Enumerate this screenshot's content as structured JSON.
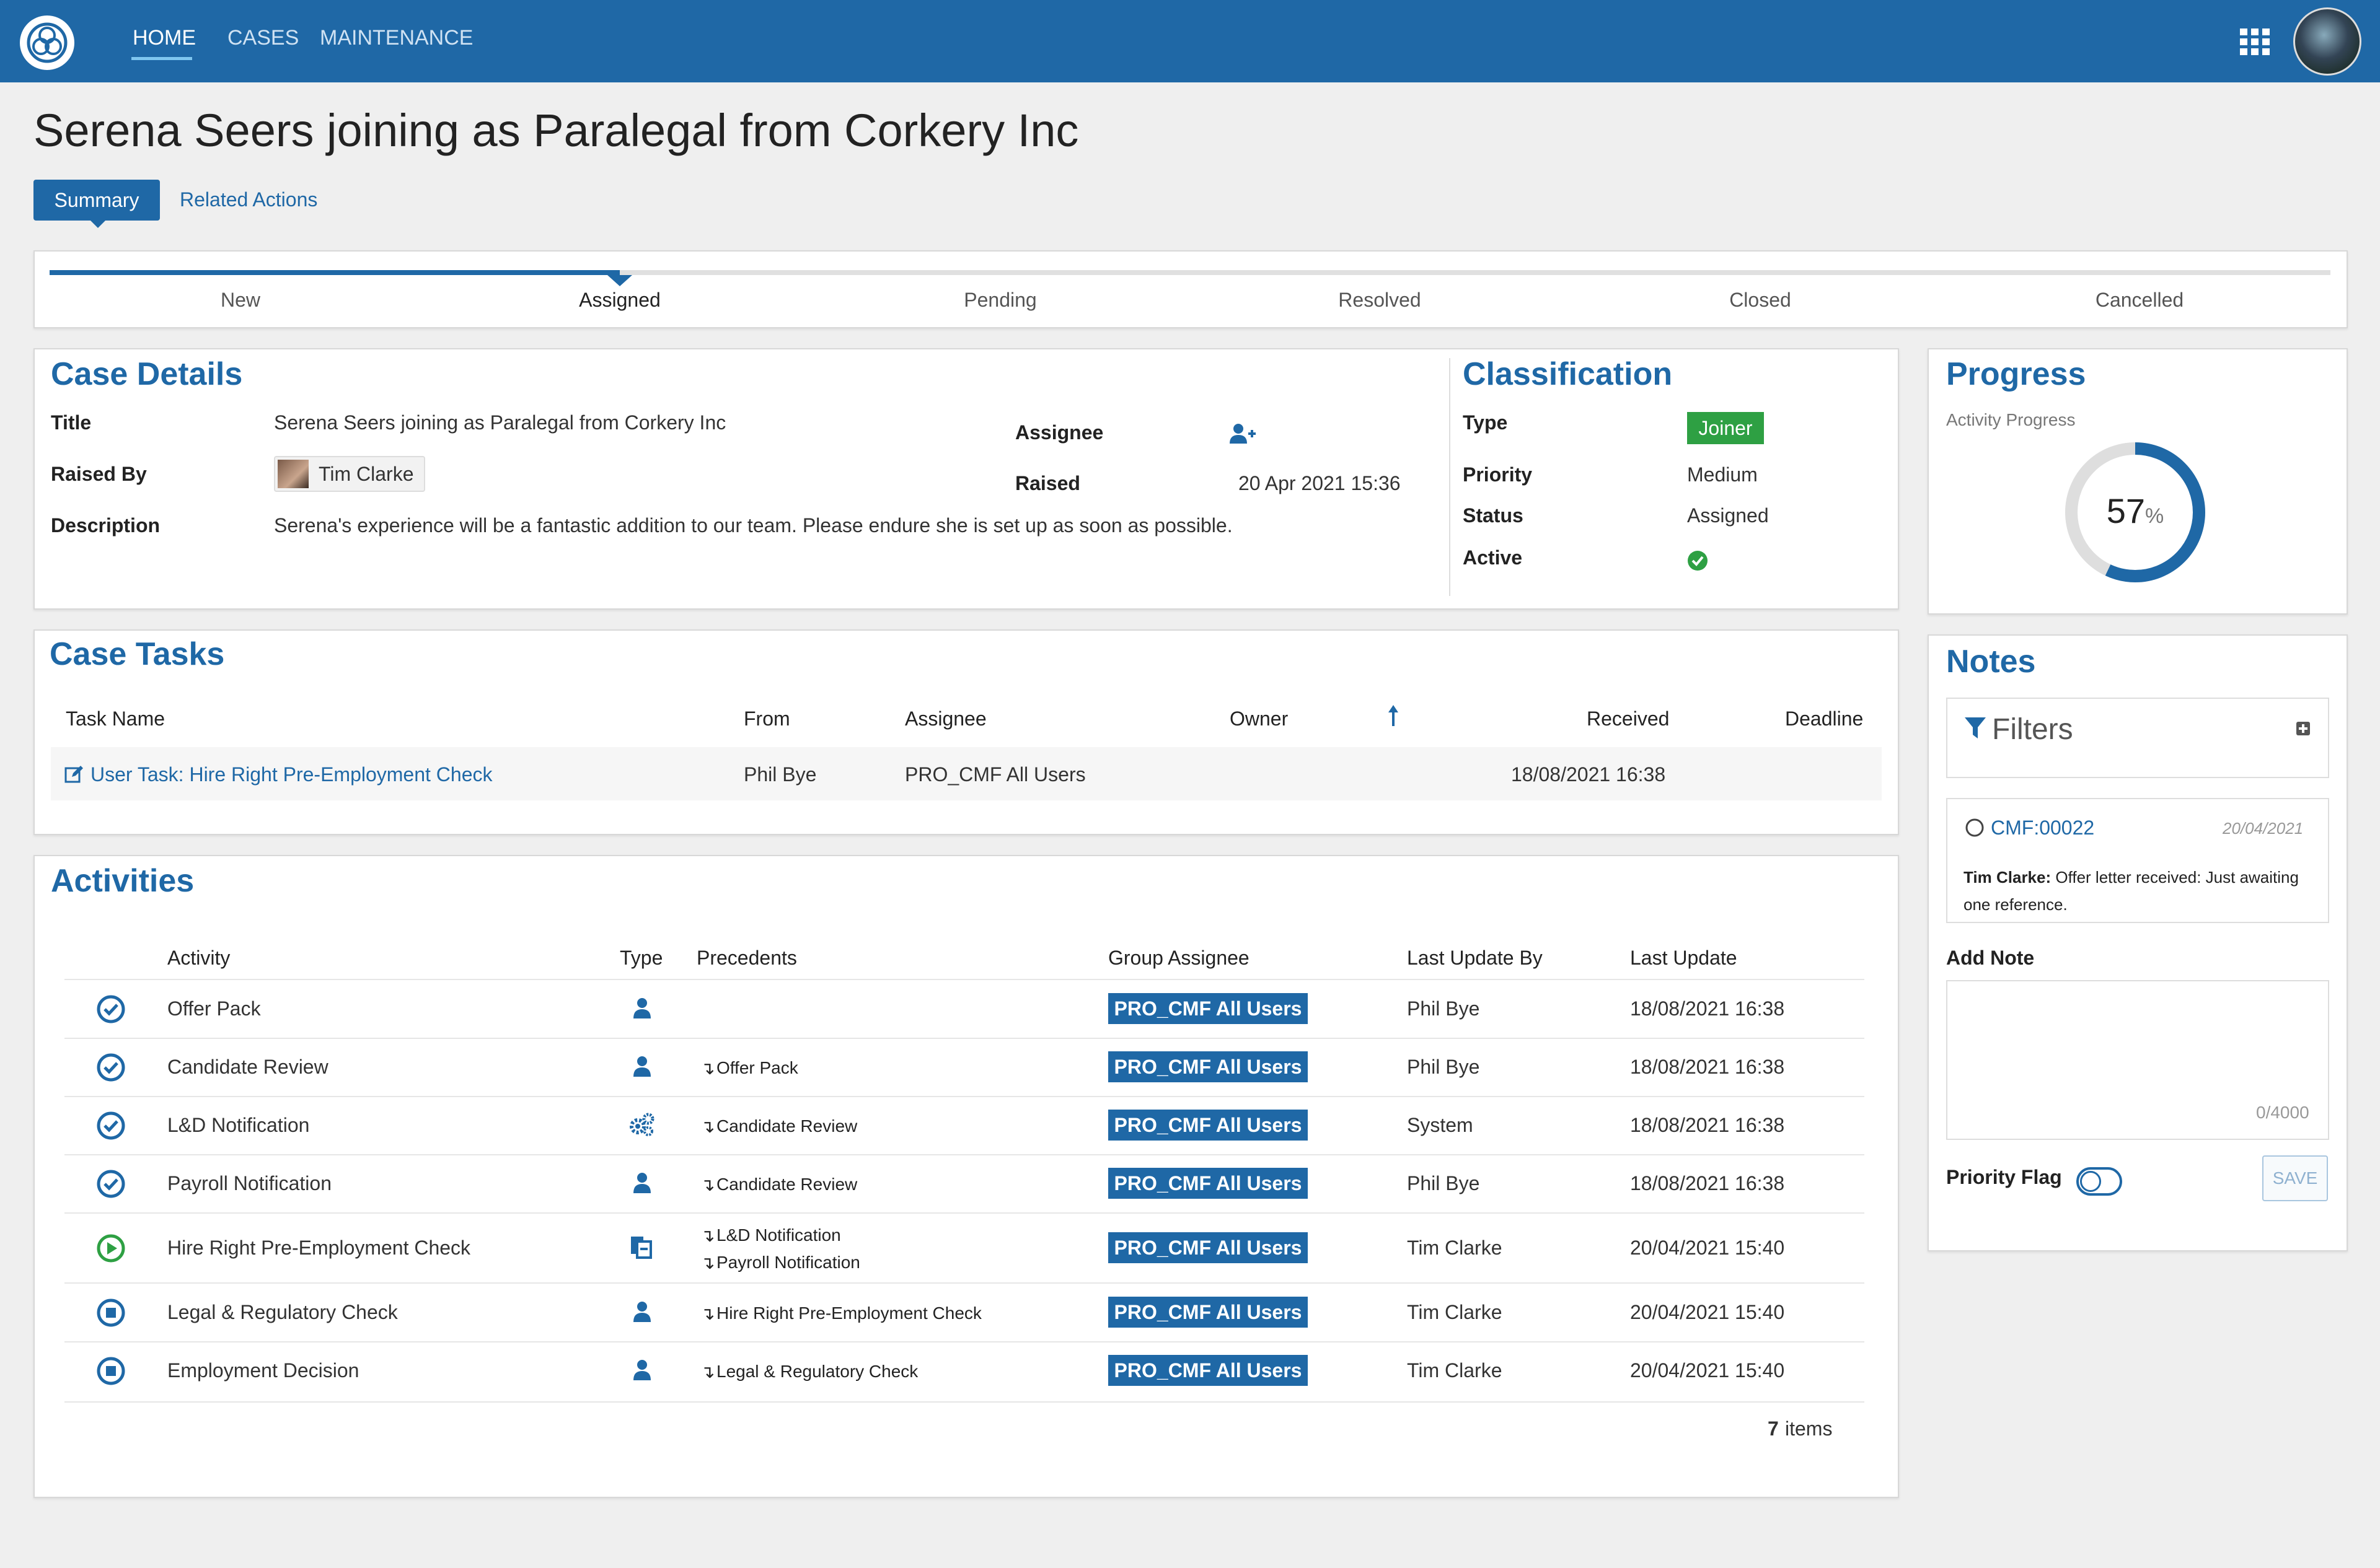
{
  "nav": {
    "home": "HOME",
    "cases": "CASES",
    "maintenance": "MAINTENANCE"
  },
  "page": {
    "title": "Serena Seers joining as Paralegal from Corkery Inc"
  },
  "tabs": {
    "summary": "Summary",
    "related": "Related Actions"
  },
  "stages": [
    "New",
    "Assigned",
    "Pending",
    "Resolved",
    "Closed",
    "Cancelled"
  ],
  "current_stage": "Assigned",
  "case_details": {
    "heading": "Case Details",
    "title_label": "Title",
    "title_value": "Serena Seers joining as Paralegal from Corkery Inc",
    "raised_by_label": "Raised By",
    "raised_by_value": "Tim Clarke",
    "description_label": "Description",
    "description_value": "Serena's experience will be a fantastic addition to our team. Please endure she is set up as soon as possible.",
    "assignee_label": "Assignee",
    "raised_label": "Raised",
    "raised_value": "20 Apr 2021 15:36"
  },
  "classification": {
    "heading": "Classification",
    "type_label": "Type",
    "type_value": "Joiner",
    "priority_label": "Priority",
    "priority_value": "Medium",
    "status_label": "Status",
    "status_value": "Assigned",
    "active_label": "Active"
  },
  "progress": {
    "heading": "Progress",
    "subtitle": "Activity Progress",
    "value": "57",
    "unit": "%",
    "fraction": 0.57
  },
  "case_tasks": {
    "heading": "Case Tasks",
    "columns": {
      "task_name": "Task Name",
      "from": "From",
      "assignee": "Assignee",
      "owner": "Owner",
      "received": "Received",
      "deadline": "Deadline"
    },
    "rows": [
      {
        "task_name": "User Task: Hire Right Pre-Employment Check",
        "from": "Phil Bye",
        "assignee": "PRO_CMF All Users",
        "owner": "",
        "received": "18/08/2021 16:38",
        "deadline": ""
      }
    ]
  },
  "activities": {
    "heading": "Activities",
    "columns": {
      "activity": "Activity",
      "type": "Type",
      "precedents": "Precedents",
      "group_assignee": "Group Assignee",
      "last_update_by": "Last Update By",
      "last_update": "Last Update"
    },
    "rows": [
      {
        "status": "complete",
        "activity": "Offer Pack",
        "type_icon": "user-icon",
        "precedents": [],
        "group": "PRO_CMF All Users",
        "by": "Phil Bye",
        "updated": "18/08/2021 16:38"
      },
      {
        "status": "complete",
        "activity": "Candidate Review",
        "type_icon": "user-icon",
        "precedents": [
          "Offer Pack"
        ],
        "group": "PRO_CMF All Users",
        "by": "Phil Bye",
        "updated": "18/08/2021 16:38"
      },
      {
        "status": "complete",
        "activity": "L&D Notification",
        "type_icon": "gears-icon",
        "precedents": [
          "Candidate Review"
        ],
        "group": "PRO_CMF All Users",
        "by": "System",
        "updated": "18/08/2021 16:38"
      },
      {
        "status": "complete",
        "activity": "Payroll Notification",
        "type_icon": "user-icon",
        "precedents": [
          "Candidate Review"
        ],
        "group": "PRO_CMF All Users",
        "by": "Phil Bye",
        "updated": "18/08/2021 16:38"
      },
      {
        "status": "in-progress",
        "activity": "Hire Right Pre-Employment Check",
        "type_icon": "documents-icon",
        "precedents": [
          "L&D Notification",
          "Payroll Notification"
        ],
        "group": "PRO_CMF All Users",
        "by": "Tim Clarke",
        "updated": "20/04/2021 15:40"
      },
      {
        "status": "stopped",
        "activity": "Legal & Regulatory Check",
        "type_icon": "user-icon",
        "precedents": [
          "Hire Right Pre-Employment Check"
        ],
        "group": "PRO_CMF All Users",
        "by": "Tim Clarke",
        "updated": "20/04/2021 15:40"
      },
      {
        "status": "stopped",
        "activity": "Employment Decision",
        "type_icon": "user-icon",
        "precedents": [
          "Legal & Regulatory Check"
        ],
        "group": "PRO_CMF All Users",
        "by": "Tim Clarke",
        "updated": "20/04/2021 15:40"
      }
    ],
    "footer_count": "7",
    "footer_label": "items"
  },
  "notes": {
    "heading": "Notes",
    "filters_label": "Filters",
    "items": [
      {
        "ref": "CMF:00022",
        "date": "20/04/2021",
        "author": "Tim Clarke:",
        "text": "Offer letter received: Just awaiting one reference."
      }
    ],
    "add_note_label": "Add Note",
    "char_counter": "0/4000",
    "priority_flag_label": "Priority Flag",
    "save_label": "SAVE"
  },
  "colors": {
    "brand": "#1f68a6",
    "success": "#2ea043",
    "background": "#efefef"
  }
}
